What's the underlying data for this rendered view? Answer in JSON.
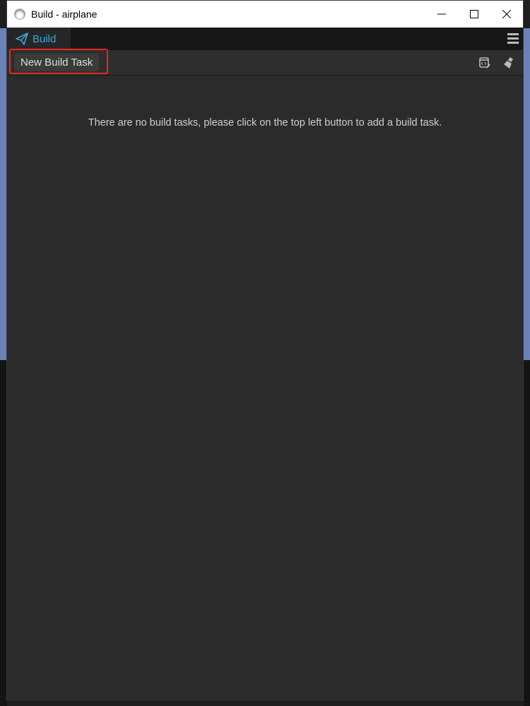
{
  "window": {
    "title": "Build - airplane"
  },
  "tabs": [
    {
      "label": "Build",
      "icon": "paper-plane-icon",
      "active": true
    }
  ],
  "toolbar": {
    "new_build_task_label": "New Build Task"
  },
  "main": {
    "empty_message": "There are no build tasks, please click on the top left button to add a build task."
  },
  "colors": {
    "accent": "#3ea6d8",
    "highlight": "#e8281f"
  }
}
